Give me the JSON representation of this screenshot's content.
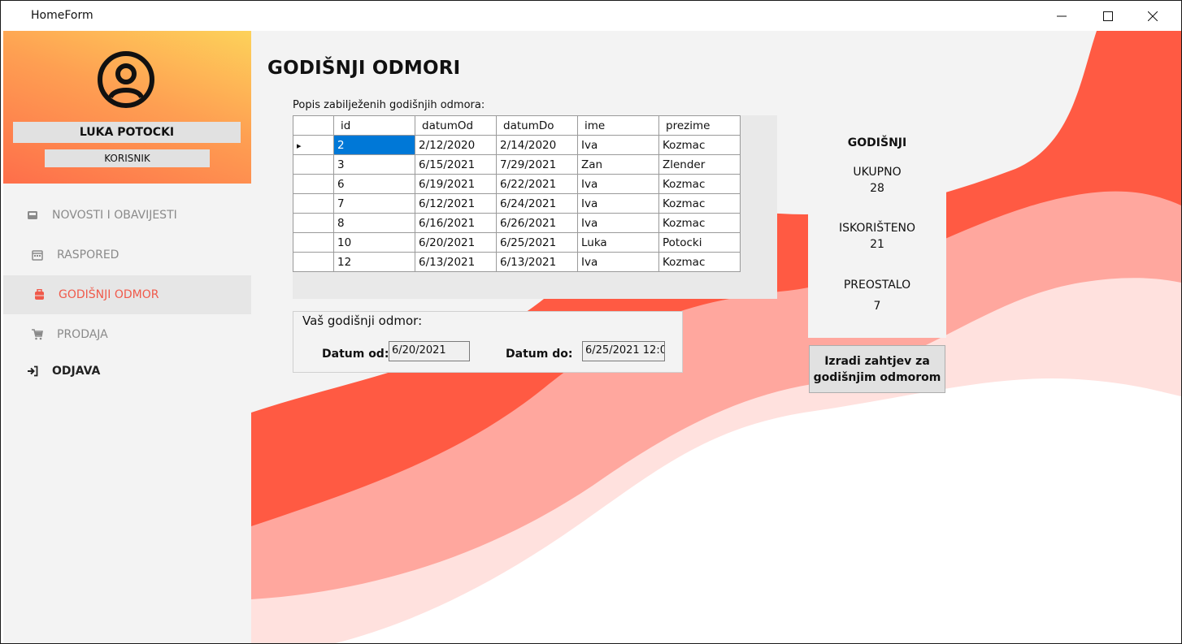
{
  "window": {
    "title": "HomeForm",
    "minimize": "—",
    "maximize": "☐",
    "close": "✕"
  },
  "profile": {
    "name": "LUKA POTOCKI",
    "role": "KORISNIK",
    "icon": "user-circle-icon"
  },
  "nav": [
    {
      "label": "NOVOSTI I OBAVIJESTI",
      "icon": "inbox-icon"
    },
    {
      "label": "RASPORED",
      "icon": "calendar-icon"
    },
    {
      "label": "GODIŠNJI ODMOR",
      "icon": "suitcase-icon"
    },
    {
      "label": "PRODAJA",
      "icon": "cart-icon"
    },
    {
      "label": "ODJAVA",
      "icon": "sign-out-icon"
    }
  ],
  "page": {
    "title": "GODIŠNJI ODMORI",
    "list_label": "Popis zabilježenih godišnjih odmora:"
  },
  "grid": {
    "columns": [
      "id",
      "datumOd",
      "datumDo",
      "ime",
      "prezime"
    ],
    "rows": [
      [
        "2",
        "2/12/2020",
        "2/14/2020",
        "Iva",
        "Kozmac"
      ],
      [
        "3",
        "6/15/2021",
        "7/29/2021",
        "Zan",
        "Zlender"
      ],
      [
        "6",
        "6/19/2021",
        "6/22/2021",
        "Iva",
        "Kozmac"
      ],
      [
        "7",
        "6/12/2021",
        "6/24/2021",
        "Iva",
        "Kozmac"
      ],
      [
        "8",
        "6/16/2021",
        "6/26/2021",
        "Iva",
        "Kozmac"
      ],
      [
        "10",
        "6/20/2021",
        "6/25/2021",
        "Luka",
        "Potocki"
      ],
      [
        "12",
        "6/13/2021",
        "6/13/2021",
        "Iva",
        "Kozmac"
      ]
    ],
    "row_marker": "▸"
  },
  "vacation": {
    "group_title": "Vaš godišnji odmor:",
    "from_label": "Datum od:",
    "from_value": "6/20/2021",
    "to_label": "Datum do:",
    "to_value": "6/25/2021 12:0"
  },
  "stats": {
    "heading": "GODIŠNJI",
    "total_label": "UKUPNO",
    "total_value": "28",
    "used_label": "ISKORIŠTENO",
    "used_value": "21",
    "left_label": "PREOSTALO",
    "left_value": "7"
  },
  "request_button": {
    "line1": "Izradi zahtjev za",
    "line2": "godišnjim odmorom"
  },
  "colors": {
    "accent": "#f05a4b",
    "wave_dark": "#ff5a43",
    "wave_mid": "#ffa79e",
    "wave_light": "#ffe1de",
    "selection": "#0078d7"
  }
}
